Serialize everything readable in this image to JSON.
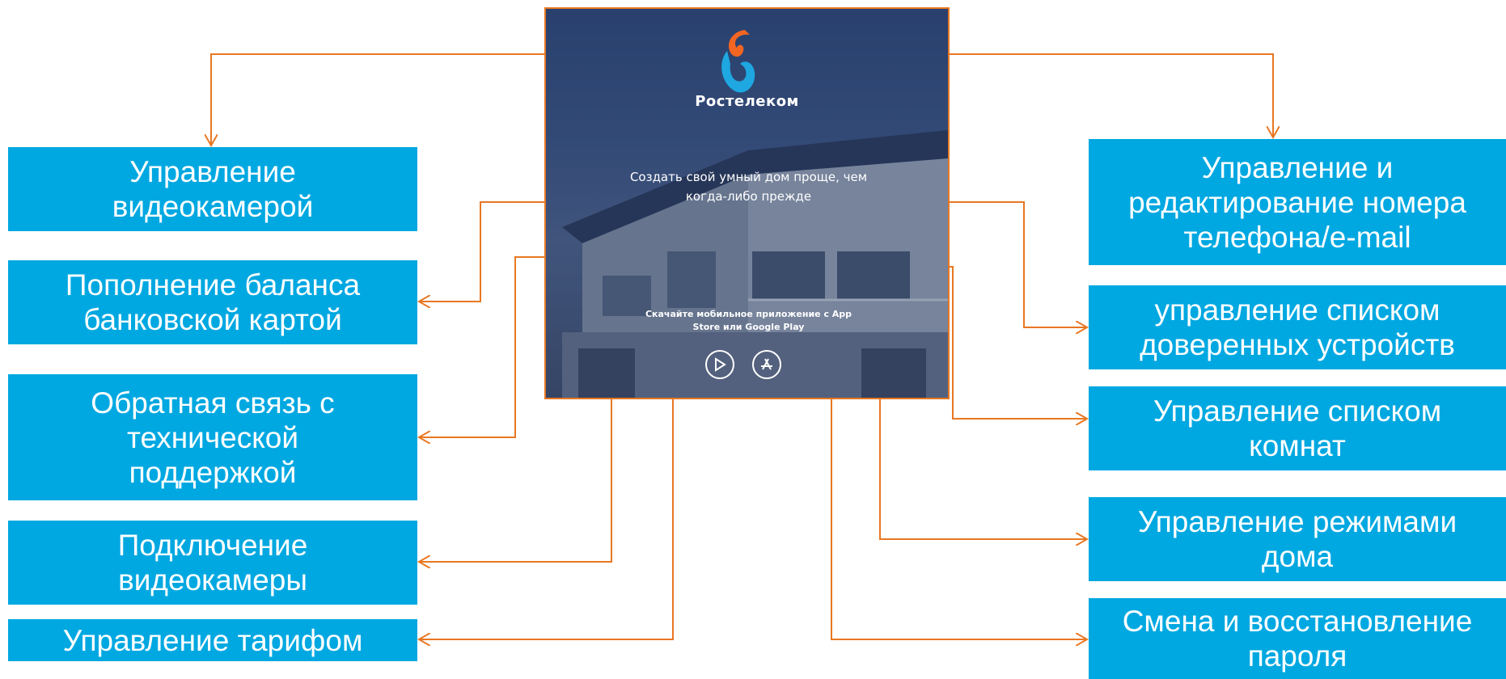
{
  "app": {
    "brand": "Ростелеком",
    "tagline": "Создать свой умный дом проще, чем когда-либо прежде",
    "download_text": "Скачайте мобильное приложение с App Store или Google Play",
    "colors": {
      "accent_orange": "#e87722",
      "box_blue": "#00a8e1"
    }
  },
  "features_left": [
    {
      "label": "Управление\nвидеокамерой"
    },
    {
      "label": "Пополнение баланса\nбанковской картой"
    },
    {
      "label": "Обратная связь с\nтехнической\nподдержкой"
    },
    {
      "label": "Подключение\nвидеокамеры"
    },
    {
      "label": "Управление тарифом"
    }
  ],
  "features_right": [
    {
      "label": "Управление и\nредактирование номера\nтелефона/e-mail"
    },
    {
      "label": "управление списком\nдоверенных устройств"
    },
    {
      "label": "Управление списком\nкомнат"
    },
    {
      "label": "Управление режимами\nдома"
    },
    {
      "label": "Смена и восстановление\nпароля"
    }
  ],
  "icons": [
    "rostelecom-logo-icon",
    "google-play-icon",
    "app-store-icon"
  ]
}
